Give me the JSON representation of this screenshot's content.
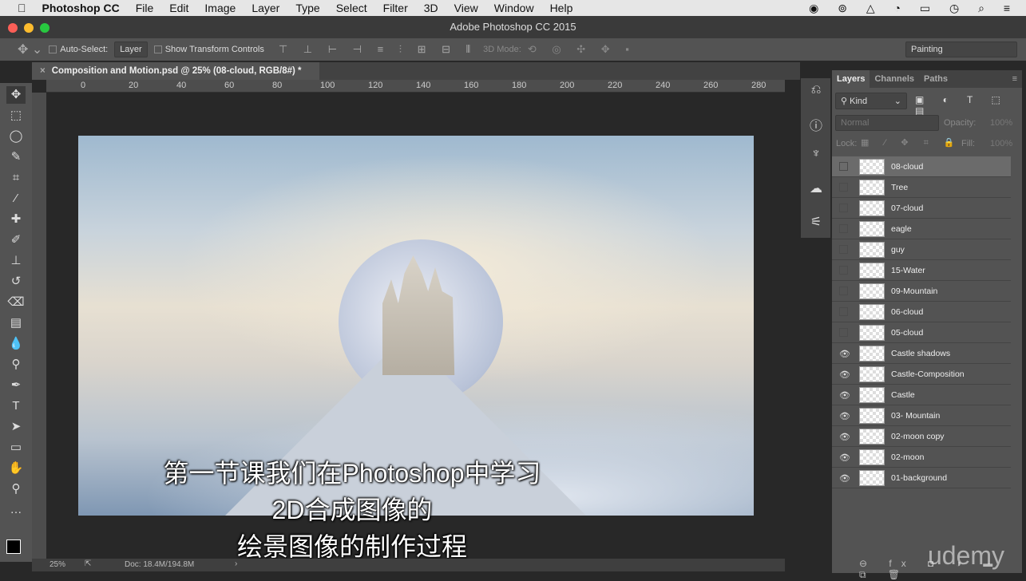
{
  "menubar": {
    "app": "Photoshop CC",
    "items": [
      "File",
      "Edit",
      "Image",
      "Layer",
      "Type",
      "Select",
      "Filter",
      "3D",
      "View",
      "Window",
      "Help"
    ]
  },
  "window_title": "Adobe Photoshop CC 2015",
  "options": {
    "auto_select_label": "Auto-Select:",
    "auto_select_value": "Layer",
    "show_transform": "Show Transform Controls",
    "mode_3d": "3D Mode:",
    "workspace": "Painting"
  },
  "document_tab": "Composition and Motion.psd @ 25% (08-cloud, RGB/8#) *",
  "ruler_ticks": [
    "0",
    "20",
    "40",
    "60",
    "80",
    "100",
    "120",
    "140",
    "160",
    "180",
    "200",
    "220",
    "240",
    "260",
    "280"
  ],
  "subtitles": [
    "第一节课我们在Photoshop中学习",
    "2D合成图像的",
    "绘景图像的制作过程"
  ],
  "status": {
    "zoom": "25%",
    "doc": "Doc: 18.4M/194.8M"
  },
  "layers_panel": {
    "tabs": [
      "Layers",
      "Channels",
      "Paths"
    ],
    "filter": "Kind",
    "blend": "Normal",
    "opacity_label": "Opacity:",
    "opacity": "100%",
    "lock_label": "Lock:",
    "fill_label": "Fill:",
    "fill": "100%",
    "layers": [
      {
        "name": "08-cloud",
        "visible": false,
        "selected": true
      },
      {
        "name": "Tree",
        "visible": false
      },
      {
        "name": "07-cloud",
        "visible": false
      },
      {
        "name": "eagle",
        "visible": false
      },
      {
        "name": "guy",
        "visible": false
      },
      {
        "name": "15-Water",
        "visible": false
      },
      {
        "name": "09-Mountain",
        "visible": false
      },
      {
        "name": "06-cloud",
        "visible": false
      },
      {
        "name": "05-cloud",
        "visible": false
      },
      {
        "name": "Castle shadows",
        "visible": true
      },
      {
        "name": "Castle-Composition",
        "visible": true
      },
      {
        "name": "Castle",
        "visible": true
      },
      {
        "name": "03- Mountain",
        "visible": true
      },
      {
        "name": "02-moon copy",
        "visible": true
      },
      {
        "name": "02-moon",
        "visible": true
      },
      {
        "name": "01-background",
        "visible": true
      }
    ]
  },
  "watermark": "udemy"
}
